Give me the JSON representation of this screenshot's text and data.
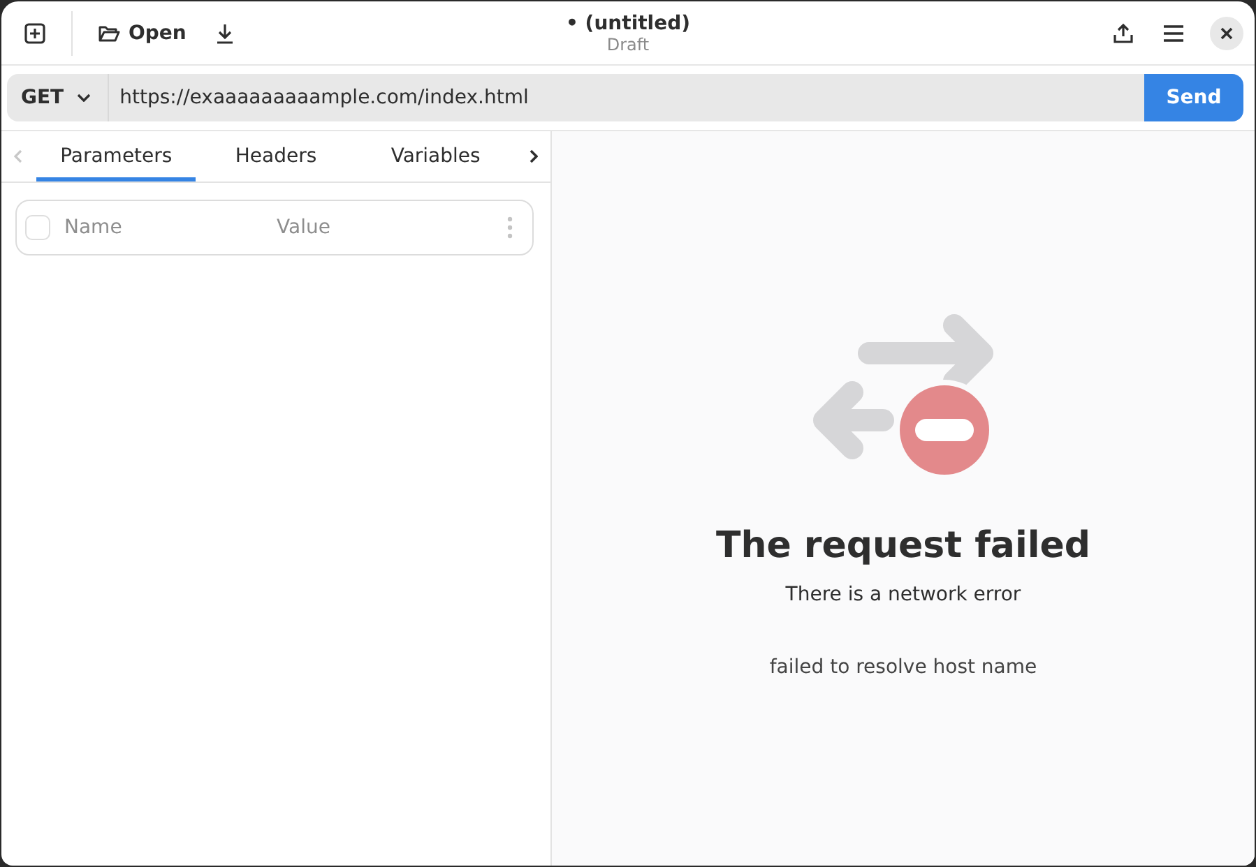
{
  "header": {
    "open_label": "Open",
    "title": "• (untitled)",
    "subtitle": "Draft"
  },
  "request": {
    "method": "GET",
    "url": "https://exaaaaaaaaample.com/index.html",
    "send_label": "Send"
  },
  "tabs": [
    {
      "label": "Parameters",
      "selected": true
    },
    {
      "label": "Headers",
      "selected": false
    },
    {
      "label": "Variables",
      "selected": false
    }
  ],
  "params_header": {
    "checked": false,
    "name_placeholder": "Name",
    "value_placeholder": "Value"
  },
  "error": {
    "title": "The request failed",
    "message": "There is a network error",
    "detail": "failed to resolve host name"
  }
}
